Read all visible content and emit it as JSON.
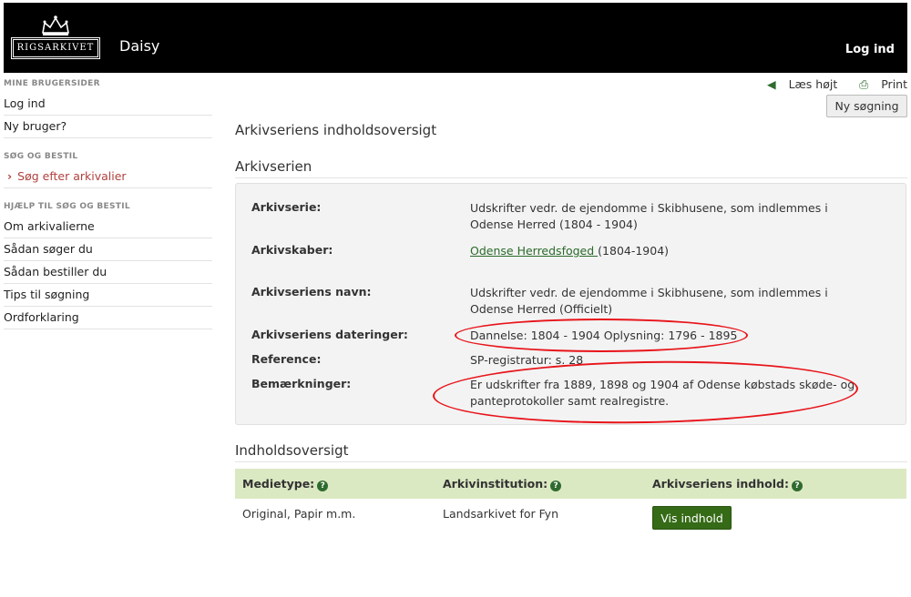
{
  "header": {
    "logo_text": "RIGSARKIVET",
    "app_name": "Daisy",
    "login_label": "Log ind"
  },
  "sidebar": {
    "sections": [
      {
        "heading": "MINE BRUGERSIDER",
        "items": [
          "Log ind",
          "Ny bruger?"
        ]
      },
      {
        "heading": "SØG OG BESTIL",
        "items": [
          "Søg efter arkivalier"
        ]
      },
      {
        "heading": "HJÆLP TIL SØG OG BESTIL",
        "items": [
          "Om arkivalierne",
          "Sådan søger du",
          "Sådan bestiller du",
          "Tips til søgning",
          "Ordforklaring"
        ]
      }
    ]
  },
  "tools": {
    "read_aloud": "Læs højt",
    "print": "Print"
  },
  "new_search_label": "Ny søgning",
  "page_title": "Arkivseriens indholdsoversigt",
  "series_section_title": "Arkivserien",
  "details": {
    "arkivserie_label": "Arkivserie:",
    "arkivserie_value": "Udskrifter vedr. de ejendomme i Skibhusene, som indlemmes i Odense Herred (1804 - 1904)",
    "arkivskaber_label": "Arkivskaber:",
    "arkivskaber_link": "Odense Herredsfoged ",
    "arkivskaber_years": "(1804-1904)",
    "navn_label": "Arkivseriens navn:",
    "navn_value": "Udskrifter vedr. de ejendomme i Skibhusene, som indlemmes i Odense Herred (Officielt)",
    "dateringer_label": "Arkivseriens dateringer:",
    "dateringer_value": "Dannelse: 1804 - 1904 Oplysning: 1796 - 1895",
    "reference_label": "Reference:",
    "reference_value": "SP-registratur: s. 28",
    "bemaerkninger_label": "Bemærkninger:",
    "bemaerkninger_value": "Er udskrifter fra 1889, 1898 og 1904 af Odense købstads skøde- og panteprotokoller samt realregistre."
  },
  "contents_section_title": "Indholdsoversigt",
  "table": {
    "headers": [
      "Medietype:",
      "Arkivinstitution:",
      "Arkivseriens indhold:"
    ],
    "row": {
      "medietype": "Original, Papir m.m.",
      "institution": "Landsarkivet for Fyn",
      "button": "Vis indhold"
    }
  },
  "colors": {
    "annotation": "#e8141a",
    "accent_green": "#356a16",
    "table_header": "#dbe9c2"
  }
}
